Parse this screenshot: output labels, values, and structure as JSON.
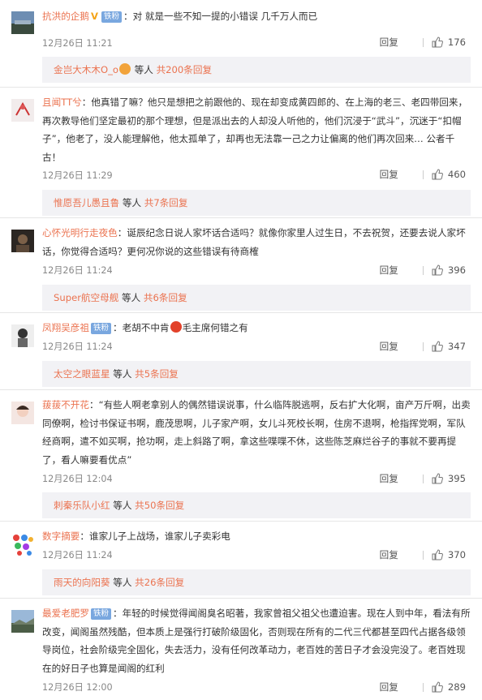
{
  "comments": [
    {
      "user": "抗洪的企鹅",
      "badge": "铁粉",
      "verified": true,
      "text": "：对 就是一些不知一提的小错误 几千万人而已",
      "time": "12月26日 11:21",
      "reply_label": "回复",
      "likes": "176",
      "sub_user": "金岂大木木O_o",
      "sub_mid": " 等人 ",
      "sub_count": "共200条回复"
    },
    {
      "user": "且闻TT兮",
      "text": "：他真错了嘛？他只是想把之前跟他的、现在却变成黄四郎的、在上海的老三、老四带回来，再次教导他们坚定最初的那个理想，但是派出去的人却没人听他的，他们沉浸于“武斗”，沉迷于“扣帽子”，他老了，没人能理解他，他太孤单了，却再也无法靠一己之力让偏离的他们再次回来… 公者千古！",
      "time": "12月26日 11:29",
      "reply_label": "回复",
      "likes": "460",
      "sub_user": "惟愿吾儿愚且鲁",
      "sub_mid": " 等人 ",
      "sub_count": "共7条回复"
    },
    {
      "user": "心怀光明行走夜色",
      "text": "：诞辰纪念日说人家坏话合适吗？就像你家里人过生日，不去祝贺，还要去说人家坏话，你觉得合适吗？更何况你说的这些错误有待商榷",
      "time": "12月26日 11:24",
      "reply_label": "回复",
      "likes": "396",
      "sub_user": "Super航空母舰",
      "sub_mid": " 等人 ",
      "sub_count": "共6条回复"
    },
    {
      "user": "凤翔吴彦祖",
      "badge": "铁粉",
      "text_a": "：老胡不中肯",
      "text_b": "毛主席何错之有",
      "time": "12月26日 11:24",
      "reply_label": "回复",
      "likes": "347",
      "sub_user": "太空之眼蓝星",
      "sub_mid": " 等人 ",
      "sub_count": "共5条回复"
    },
    {
      "user": "菝菝不开花",
      "text": "：“有些人啊老拿别人的偶然错误说事，什么临阵脱逃啊，反右扩大化啊，亩产万斤啊，出卖同僚啊，检讨书保证书啊，鹿茂思啊，儿子家产啊，女儿斗死校长啊，住房不退啊，枪指挥党啊，军队经商啊，遣不如买啊，抢功啊，走上斜路了啊，拿这些喋喋不休，这些陈芝麻烂谷子的事就不要再提了，看人嘛要看优点”",
      "time": "12月26日 12:04",
      "reply_label": "回复",
      "likes": "395",
      "sub_user": "刺秦乐队小红",
      "sub_mid": " 等人 ",
      "sub_count": "共50条回复"
    },
    {
      "user": "数字摘要",
      "text": "：谁家儿子上战场，谁家儿子卖彩电",
      "time": "12月26日 11:24",
      "reply_label": "回复",
      "likes": "370",
      "sub_user": "雨天的向阳葵",
      "sub_mid": " 等人 ",
      "sub_count": "共26条回复"
    },
    {
      "user": "最爱老肥罗",
      "badge": "铁粉",
      "text": "：年轻的时候觉得闻阁臭名昭著，我家曾祖父祖父也遭迫害。现在人到中年，看法有所改变，闻阁虽然残酷，但本质上是强行打破阶级固化，否则现在所有的二代三代都甚至四代占据各级领导岗位，社会阶级完全固化，失去活力，没有任何改革动力，老百姓的苦日子才会没完没了。老百姓现在的好日子也算是闻阁的红利",
      "time": "12月26日 12:00",
      "reply_label": "回复",
      "likes": "289"
    }
  ],
  "icons": {
    "like": "thumbs-up-icon",
    "verified": "v-badge-icon",
    "emoji": "angry-face-icon"
  },
  "colors": {
    "username": "#eb7350",
    "badge": "#79a7df",
    "reply_bg": "#f2f2f5"
  }
}
